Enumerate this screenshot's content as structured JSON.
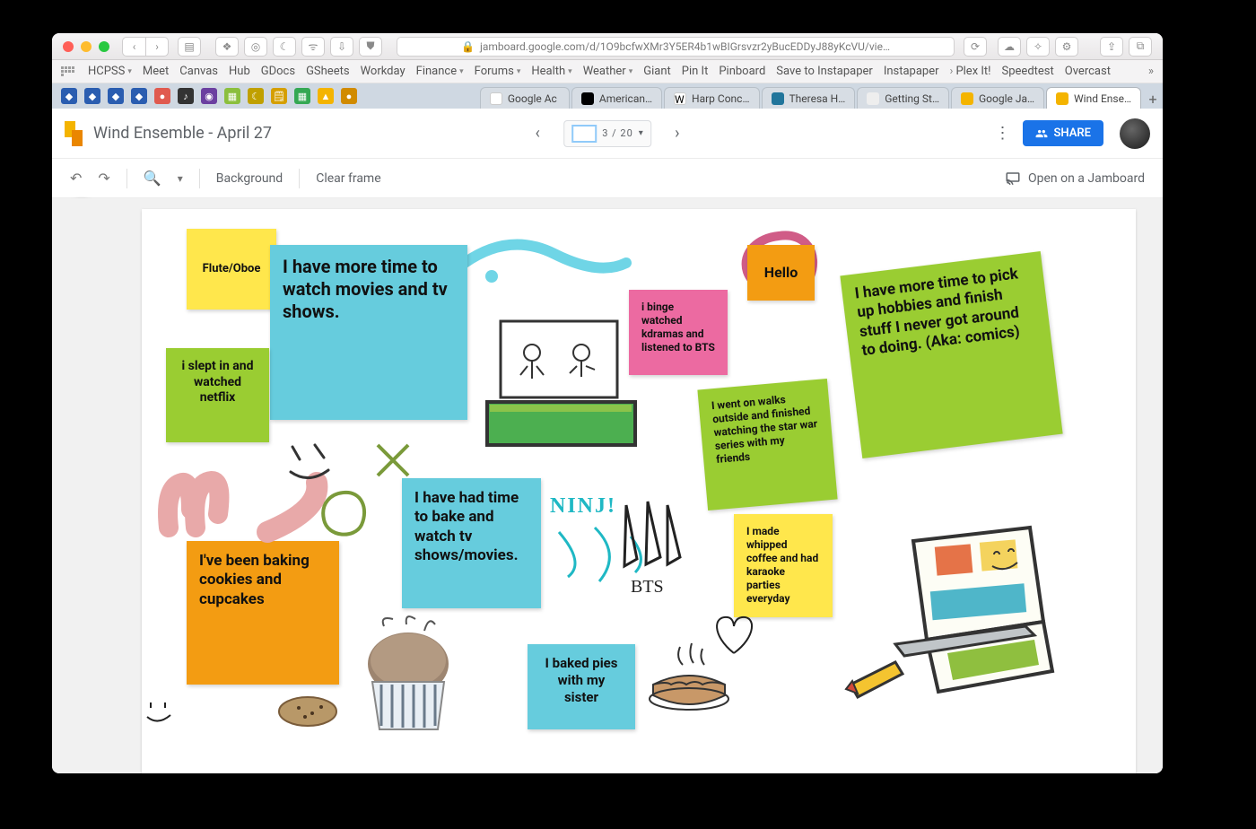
{
  "browser": {
    "url": "jamboard.google.com/d/1O9bcfwXMr3Y5ER4b1wBIGrsvzr2yBucEDDyJ88yKcVU/vie…",
    "bookmarks": [
      "HCPSS",
      "Meet",
      "Canvas",
      "Hub",
      "GDocs",
      "GSheets",
      "Workday",
      "Finance",
      "Forums",
      "Health",
      "Weather",
      "Giant",
      "Pin It",
      "Pinboard",
      "Save to Instapaper",
      "Instapaper",
      "Plex It!",
      "Speedtest",
      "Overcast"
    ],
    "tabs": [
      "Google Ac",
      "American…",
      "Harp Conc…",
      "Theresa H…",
      "Getting St…",
      "Google Ja…",
      "Wind Ense…"
    ]
  },
  "jamboard": {
    "title": "Wind Ensemble - April 27",
    "page": "3 / 20",
    "share": "SHARE",
    "background": "Background",
    "clear": "Clear frame",
    "open": "Open on a Jamboard"
  },
  "notes": {
    "flute": "Flute/Oboe",
    "movies": "I have more time to watch movies and tv shows.",
    "netflix": "i slept in and watched netflix",
    "kdramas": "i binge watched kdramas and listened to BTS",
    "hello": "Hello",
    "hobbies": "I have more time to pick up hobbies and finish stuff I never got around to doing. (Aka: comics)",
    "starwars": "I went on walks outside and finished watching the star war series with my friends",
    "bake": "I have had time to bake and watch tv shows/movies.",
    "coffee": "I made whipped coffee and had karaoke parties everyday",
    "cookies": "I've been baking cookies and cupcakes",
    "pies": "I baked pies with my sister",
    "bts_label": "BTS",
    "ninji": "NINJ!"
  }
}
